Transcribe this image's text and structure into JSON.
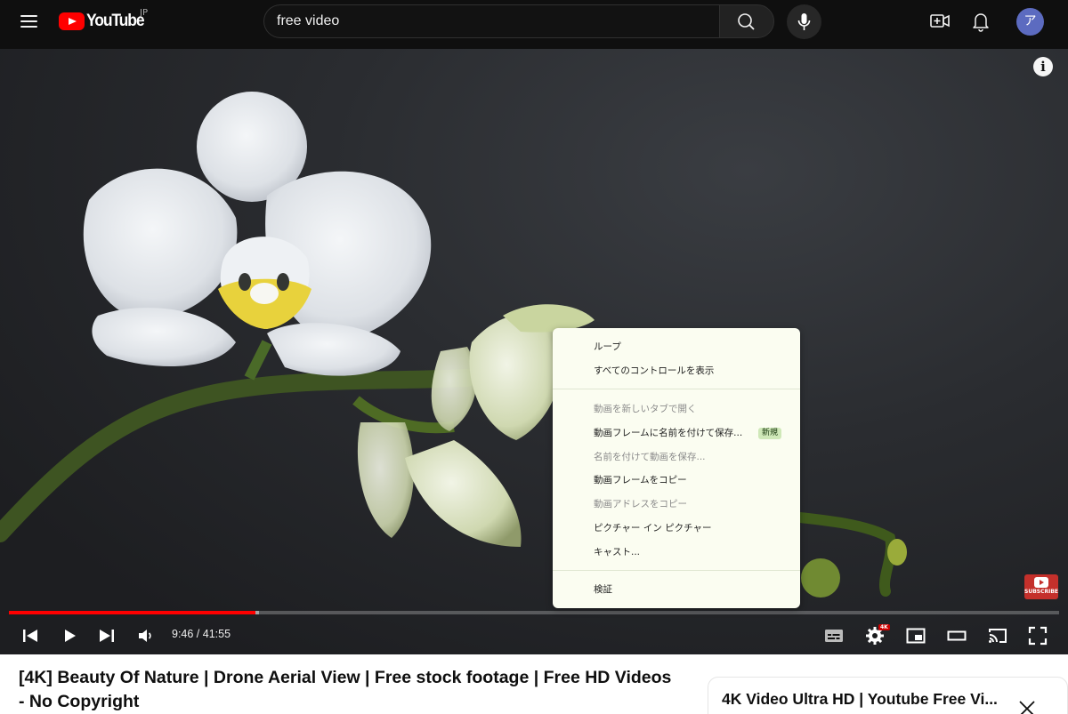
{
  "header": {
    "logo_text": "YouTube",
    "logo_region": "JP",
    "search": {
      "value": "free video",
      "placeholder": "検索"
    },
    "avatar_initial": "ア"
  },
  "player": {
    "time_display": "9:46 / 41:55",
    "progress": {
      "played_fraction": 0.235,
      "buffered_fraction": 0.238
    },
    "settings_badge": "4K",
    "info_glyph": "i",
    "watermark_text": "SUBSCRIBE"
  },
  "context_menu": {
    "groups": [
      [
        {
          "label": "ループ",
          "disabled": false
        },
        {
          "label": "すべてのコントロールを表示",
          "disabled": false
        }
      ],
      [
        {
          "label": "動画を新しいタブで開く",
          "disabled": true
        },
        {
          "label": "動画フレームに名前を付けて保存...",
          "disabled": false,
          "badge": "新規"
        },
        {
          "label": "名前を付けて動画を保存...",
          "disabled": true
        },
        {
          "label": "動画フレームをコピー",
          "disabled": false
        },
        {
          "label": "動画アドレスをコピー",
          "disabled": true
        },
        {
          "label": "ピクチャー イン ピクチャー",
          "disabled": false
        },
        {
          "label": "キャスト...",
          "disabled": false
        }
      ],
      [
        {
          "label": "検証",
          "disabled": false
        }
      ]
    ]
  },
  "video": {
    "title": "[4K] Beauty Of Nature | Drone Aerial View | Free stock footage | Free HD Videos - No Copyright"
  },
  "sidebar_card": {
    "title": "4K Video Ultra HD | Youtube Free Vi..."
  },
  "colors": {
    "accent_red": "#ff0000",
    "header_bg": "#0f0f0f",
    "menu_bg": "#fbfdf1",
    "avatar_bg": "#5c6bc0"
  }
}
